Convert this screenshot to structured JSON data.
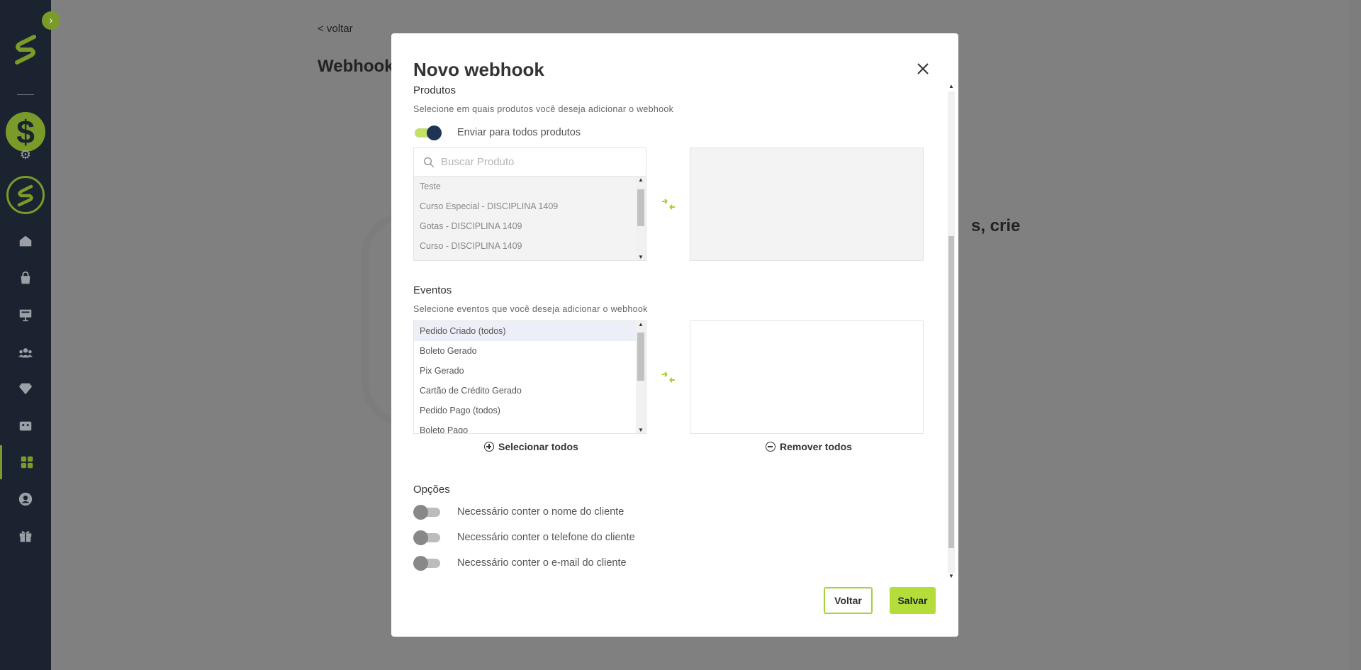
{
  "background": {
    "back_link": "< voltar",
    "page_title": "Webhook",
    "partial_text": "s, crie"
  },
  "sidebar": {
    "toggle_icon": "chevron-right-icon",
    "items": [
      {
        "icon": "home-icon"
      },
      {
        "icon": "bag-icon"
      },
      {
        "icon": "presentation-icon"
      },
      {
        "icon": "users-icon"
      },
      {
        "icon": "diamond-icon"
      },
      {
        "icon": "ticket-icon"
      },
      {
        "icon": "apps-icon",
        "active": true
      },
      {
        "icon": "user-icon"
      },
      {
        "icon": "gift-icon"
      }
    ]
  },
  "modal": {
    "title": "Novo webhook",
    "products": {
      "title": "Produtos",
      "subtitle": "Selecione em quais produtos você deseja adicionar o webhook",
      "toggle_label": "Enviar para todos produtos",
      "toggle_on": true,
      "search_placeholder": "Buscar Produto",
      "items": [
        "Teste",
        "Curso Especial - DISCIPLINA 1409",
        "Gotas - DISCIPLINA 1409",
        "Curso - DISCIPLINA 1409"
      ]
    },
    "events": {
      "title": "Eventos",
      "subtitle": "Selecione eventos que você deseja adicionar o webhook",
      "items": [
        "Pedido Criado (todos)",
        "Boleto Gerado",
        "Pix Gerado",
        "Cartão de Crédito Gerado",
        "Pedido Pago (todos)",
        "Boleto Pago"
      ],
      "select_all": "Selecionar todos",
      "remove_all": "Remover todos"
    },
    "options": {
      "title": "Opções",
      "items": [
        {
          "label": "Necessário conter o nome do cliente",
          "on": false
        },
        {
          "label": "Necessário conter o telefone do cliente",
          "on": false
        },
        {
          "label": "Necessário conter o e-mail do cliente",
          "on": false
        }
      ]
    },
    "buttons": {
      "back": "Voltar",
      "save": "Salvar"
    }
  },
  "colors": {
    "accent": "#b5dd3a",
    "sidebar_bg": "#1b2330",
    "toggle_knob_on": "#1f3454"
  }
}
